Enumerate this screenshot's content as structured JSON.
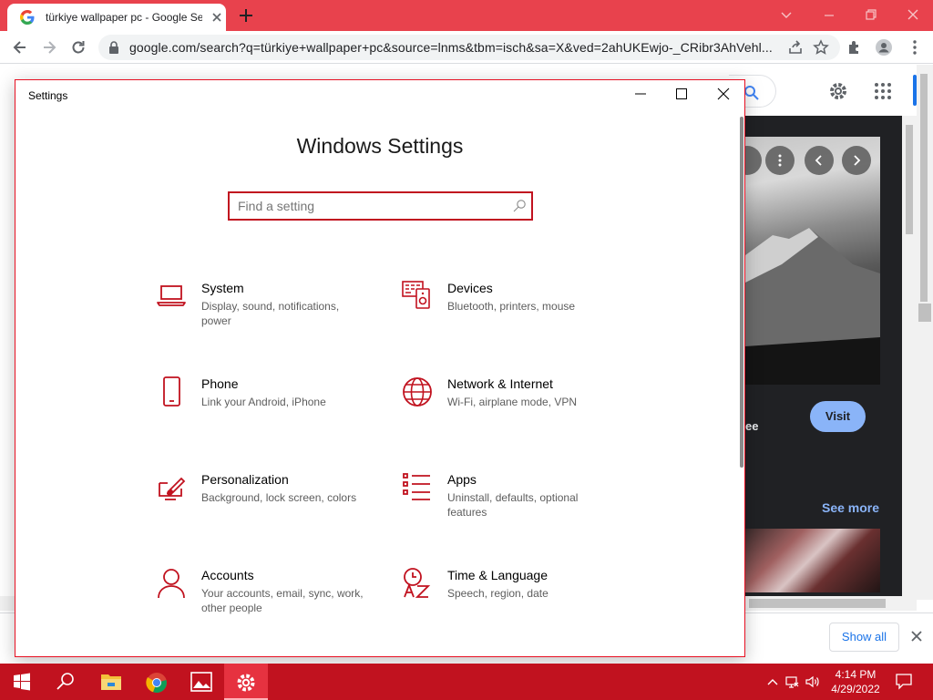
{
  "browser": {
    "tab_title": "türkiye wallpaper pc - Google Se",
    "url": "google.com/search?q=türkiye+wallpaper+pc&source=lnms&tbm=isch&sa=X&ved=2ahUKEwjo-_CRibr3AhVehl..."
  },
  "page": {
    "visit_label": "Visit",
    "see_more_label": "See more",
    "ee_text": "ee",
    "show_all_label": "Show all"
  },
  "settings": {
    "window_title": "Settings",
    "heading": "Windows Settings",
    "search_placeholder": "Find a setting",
    "tiles": [
      {
        "name": "System",
        "desc": "Display, sound, notifications, power",
        "icon": "laptop-icon"
      },
      {
        "name": "Devices",
        "desc": "Bluetooth, printers, mouse",
        "icon": "devices-icon"
      },
      {
        "name": "Phone",
        "desc": "Link your Android, iPhone",
        "icon": "phone-icon"
      },
      {
        "name": "Network & Internet",
        "desc": "Wi-Fi, airplane mode, VPN",
        "icon": "globe-icon"
      },
      {
        "name": "Personalization",
        "desc": "Background, lock screen, colors",
        "icon": "paint-icon"
      },
      {
        "name": "Apps",
        "desc": "Uninstall, defaults, optional features",
        "icon": "apps-list-icon"
      },
      {
        "name": "Accounts",
        "desc": "Your accounts, email, sync, work, other people",
        "icon": "person-icon"
      },
      {
        "name": "Time & Language",
        "desc": "Speech, region, date",
        "icon": "time-language-icon"
      }
    ]
  },
  "taskbar": {
    "time": "4:14 PM",
    "date": "4/29/2022"
  },
  "colors": {
    "accent": "#c1121f",
    "tabbar": "#e8424d",
    "link_blue": "#8ab4f8"
  }
}
